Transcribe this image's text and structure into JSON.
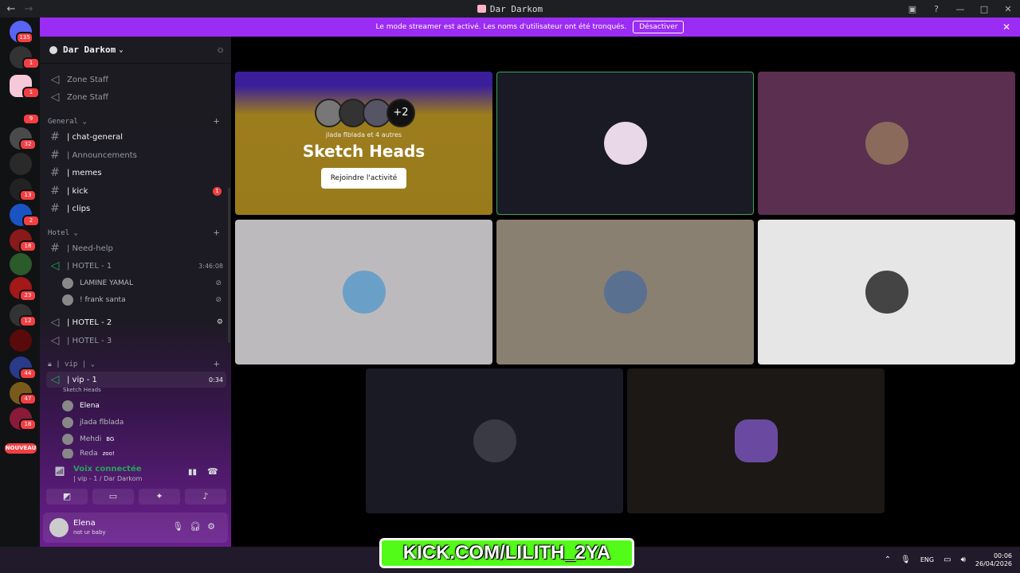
{
  "window": {
    "title": "Dar Darkom"
  },
  "banner": {
    "text": "Le mode streamer est activé. Les noms d'utilisateur ont été tronqués.",
    "button": "Désactiver"
  },
  "servers": {
    "badges": [
      "135",
      "1",
      "1",
      "9",
      "32",
      "",
      "13",
      "2",
      "18",
      "",
      "23",
      "12",
      "",
      "44",
      "47",
      "18"
    ],
    "nouveau": "NOUVEAU"
  },
  "sidebar": {
    "server_name": "Dar Darkom",
    "top_channels": [
      {
        "label": "Zone Staff"
      },
      {
        "label": "Zone Staff"
      }
    ],
    "categories": {
      "general": "General",
      "hotel": "Hotel",
      "vip": "| vip |"
    },
    "general_channels": [
      {
        "label": "| chat-general",
        "badge": ""
      },
      {
        "label": "| Announcements",
        "badge": ""
      },
      {
        "label": "| memes",
        "badge": ""
      },
      {
        "label": "| kick",
        "badge": "1"
      },
      {
        "label": "| clips",
        "badge": ""
      }
    ],
    "hotel": {
      "help": "| Need-help",
      "hotel1": "| HOTEL - 1",
      "hotel1_time": "3:46:08",
      "hotel1_users": [
        "LAMINE YAMAL",
        "!  frank santa"
      ],
      "hotel2": "| HOTEL - 2",
      "hotel3": "| HOTEL - 3"
    },
    "vip": {
      "channel": "| vip - 1",
      "time": "0:34",
      "activity": "Sketch Heads",
      "users": [
        "Elena",
        "jlada flblada",
        "Mehdi",
        "Reda"
      ],
      "user_tags": [
        "",
        "",
        "BG",
        "zoo!"
      ]
    },
    "voice": {
      "status": "Voix connectée",
      "location": "| vip - 1 / Dar Darkom"
    },
    "me": {
      "name": "Elena",
      "status": "not ur baby"
    }
  },
  "activity": {
    "by": "jlada flblada et 4 autres",
    "more": "+2",
    "name": "Sketch Heads",
    "join": "Rejoindre l'activité"
  },
  "colors": {
    "banner": "#9b2cf3",
    "speaking": "#23a55a",
    "kick": "#53fc18"
  },
  "tiles": [
    {
      "bg": "#1a1a24",
      "border": "#3ba55c"
    },
    {
      "bg": "#5a2f50",
      "border": ""
    },
    {
      "bg": "#bdbabd",
      "border": ""
    },
    {
      "bg": "#8a8072",
      "border": ""
    },
    {
      "bg": "#e6e6e6",
      "border": ""
    },
    {
      "bg": "#1a1a24",
      "border": ""
    },
    {
      "bg": "#1c1816",
      "border": ""
    }
  ],
  "overlay": {
    "kick": "KICK.COM/LILITH_2YA"
  },
  "taskbar": {
    "lang": "ENG",
    "time": "00:06",
    "date": "26/04/2026"
  }
}
